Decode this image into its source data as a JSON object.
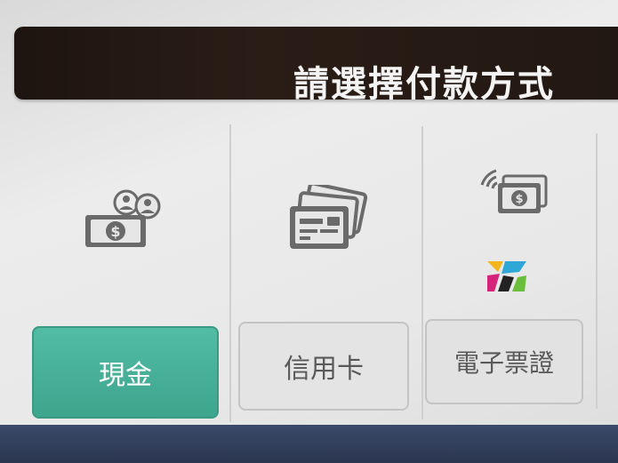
{
  "header": {
    "title": "請選擇付款方式"
  },
  "payment_options": [
    {
      "id": "cash",
      "label": "現金",
      "icon": "cash-icon",
      "selected": true
    },
    {
      "id": "credit_card",
      "label": "信用卡",
      "icon": "credit-card-icon",
      "selected": false
    },
    {
      "id": "e_ticket",
      "label": "電子票證",
      "icon": "contactless-payment-icon",
      "selected": false
    }
  ],
  "colors": {
    "header_bg": "#221712",
    "selected_button": "#47b098",
    "unselected_button": "#e4e4e4",
    "icon_gray": "#6a6a6a",
    "bottom_bar": "#2f3b57"
  }
}
